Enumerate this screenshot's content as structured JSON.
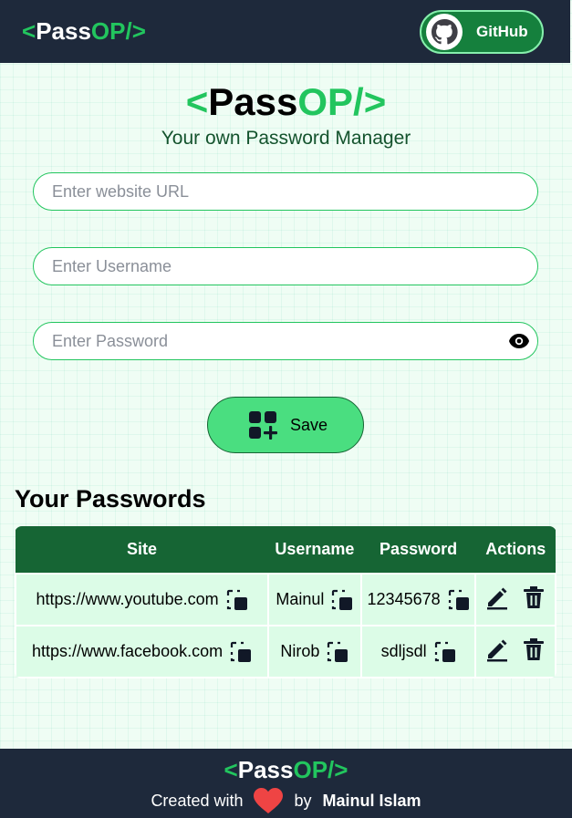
{
  "brand": {
    "lt": "<",
    "pass": "Pass",
    "op": "OP/",
    "gt": ">"
  },
  "nav": {
    "github_label": "GitHub"
  },
  "hero": {
    "subtitle": "Your own Password Manager"
  },
  "form": {
    "url_placeholder": "Enter website URL",
    "username_placeholder": "Enter Username",
    "password_placeholder": "Enter Password",
    "save_label": "Save"
  },
  "passwords": {
    "title": "Your Passwords",
    "headers": [
      "Site",
      "Username",
      "Password",
      "Actions"
    ],
    "rows": [
      {
        "site": "https://www.youtube.com",
        "username": "Mainul",
        "password": "12345678"
      },
      {
        "site": "https://www.facebook.com",
        "username": "Nirob",
        "password": "sdljsdl"
      }
    ]
  },
  "footer": {
    "created_with": "Created with",
    "by": "by",
    "author": "Mainul Islam"
  },
  "colors": {
    "accent": "#22c55e",
    "nav_bg": "#1e293b",
    "header_bg": "#166534",
    "row_bg": "#dcfce7",
    "save_bg": "#4ade80"
  }
}
